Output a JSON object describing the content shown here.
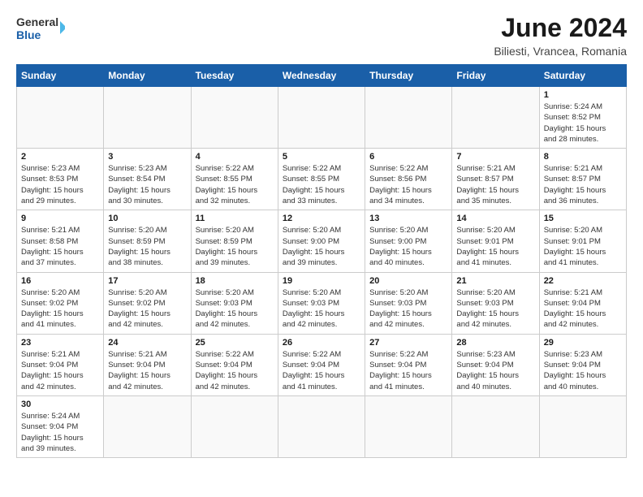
{
  "header": {
    "logo_general": "General",
    "logo_blue": "Blue",
    "title": "June 2024",
    "subtitle": "Biliesti, Vrancea, Romania"
  },
  "weekdays": [
    "Sunday",
    "Monday",
    "Tuesday",
    "Wednesday",
    "Thursday",
    "Friday",
    "Saturday"
  ],
  "weeks": [
    [
      {
        "day": "",
        "info": ""
      },
      {
        "day": "",
        "info": ""
      },
      {
        "day": "",
        "info": ""
      },
      {
        "day": "",
        "info": ""
      },
      {
        "day": "",
        "info": ""
      },
      {
        "day": "",
        "info": ""
      },
      {
        "day": "1",
        "info": "Sunrise: 5:24 AM\nSunset: 8:52 PM\nDaylight: 15 hours\nand 28 minutes."
      }
    ],
    [
      {
        "day": "2",
        "info": "Sunrise: 5:23 AM\nSunset: 8:53 PM\nDaylight: 15 hours\nand 29 minutes."
      },
      {
        "day": "3",
        "info": "Sunrise: 5:23 AM\nSunset: 8:54 PM\nDaylight: 15 hours\nand 30 minutes."
      },
      {
        "day": "4",
        "info": "Sunrise: 5:22 AM\nSunset: 8:55 PM\nDaylight: 15 hours\nand 32 minutes."
      },
      {
        "day": "5",
        "info": "Sunrise: 5:22 AM\nSunset: 8:55 PM\nDaylight: 15 hours\nand 33 minutes."
      },
      {
        "day": "6",
        "info": "Sunrise: 5:22 AM\nSunset: 8:56 PM\nDaylight: 15 hours\nand 34 minutes."
      },
      {
        "day": "7",
        "info": "Sunrise: 5:21 AM\nSunset: 8:57 PM\nDaylight: 15 hours\nand 35 minutes."
      },
      {
        "day": "8",
        "info": "Sunrise: 5:21 AM\nSunset: 8:57 PM\nDaylight: 15 hours\nand 36 minutes."
      }
    ],
    [
      {
        "day": "9",
        "info": "Sunrise: 5:21 AM\nSunset: 8:58 PM\nDaylight: 15 hours\nand 37 minutes."
      },
      {
        "day": "10",
        "info": "Sunrise: 5:20 AM\nSunset: 8:59 PM\nDaylight: 15 hours\nand 38 minutes."
      },
      {
        "day": "11",
        "info": "Sunrise: 5:20 AM\nSunset: 8:59 PM\nDaylight: 15 hours\nand 39 minutes."
      },
      {
        "day": "12",
        "info": "Sunrise: 5:20 AM\nSunset: 9:00 PM\nDaylight: 15 hours\nand 39 minutes."
      },
      {
        "day": "13",
        "info": "Sunrise: 5:20 AM\nSunset: 9:00 PM\nDaylight: 15 hours\nand 40 minutes."
      },
      {
        "day": "14",
        "info": "Sunrise: 5:20 AM\nSunset: 9:01 PM\nDaylight: 15 hours\nand 41 minutes."
      },
      {
        "day": "15",
        "info": "Sunrise: 5:20 AM\nSunset: 9:01 PM\nDaylight: 15 hours\nand 41 minutes."
      }
    ],
    [
      {
        "day": "16",
        "info": "Sunrise: 5:20 AM\nSunset: 9:02 PM\nDaylight: 15 hours\nand 41 minutes."
      },
      {
        "day": "17",
        "info": "Sunrise: 5:20 AM\nSunset: 9:02 PM\nDaylight: 15 hours\nand 42 minutes."
      },
      {
        "day": "18",
        "info": "Sunrise: 5:20 AM\nSunset: 9:03 PM\nDaylight: 15 hours\nand 42 minutes."
      },
      {
        "day": "19",
        "info": "Sunrise: 5:20 AM\nSunset: 9:03 PM\nDaylight: 15 hours\nand 42 minutes."
      },
      {
        "day": "20",
        "info": "Sunrise: 5:20 AM\nSunset: 9:03 PM\nDaylight: 15 hours\nand 42 minutes."
      },
      {
        "day": "21",
        "info": "Sunrise: 5:20 AM\nSunset: 9:03 PM\nDaylight: 15 hours\nand 42 minutes."
      },
      {
        "day": "22",
        "info": "Sunrise: 5:21 AM\nSunset: 9:04 PM\nDaylight: 15 hours\nand 42 minutes."
      }
    ],
    [
      {
        "day": "23",
        "info": "Sunrise: 5:21 AM\nSunset: 9:04 PM\nDaylight: 15 hours\nand 42 minutes."
      },
      {
        "day": "24",
        "info": "Sunrise: 5:21 AM\nSunset: 9:04 PM\nDaylight: 15 hours\nand 42 minutes."
      },
      {
        "day": "25",
        "info": "Sunrise: 5:22 AM\nSunset: 9:04 PM\nDaylight: 15 hours\nand 42 minutes."
      },
      {
        "day": "26",
        "info": "Sunrise: 5:22 AM\nSunset: 9:04 PM\nDaylight: 15 hours\nand 41 minutes."
      },
      {
        "day": "27",
        "info": "Sunrise: 5:22 AM\nSunset: 9:04 PM\nDaylight: 15 hours\nand 41 minutes."
      },
      {
        "day": "28",
        "info": "Sunrise: 5:23 AM\nSunset: 9:04 PM\nDaylight: 15 hours\nand 40 minutes."
      },
      {
        "day": "29",
        "info": "Sunrise: 5:23 AM\nSunset: 9:04 PM\nDaylight: 15 hours\nand 40 minutes."
      }
    ],
    [
      {
        "day": "30",
        "info": "Sunrise: 5:24 AM\nSunset: 9:04 PM\nDaylight: 15 hours\nand 39 minutes."
      },
      {
        "day": "",
        "info": ""
      },
      {
        "day": "",
        "info": ""
      },
      {
        "day": "",
        "info": ""
      },
      {
        "day": "",
        "info": ""
      },
      {
        "day": "",
        "info": ""
      },
      {
        "day": "",
        "info": ""
      }
    ]
  ]
}
